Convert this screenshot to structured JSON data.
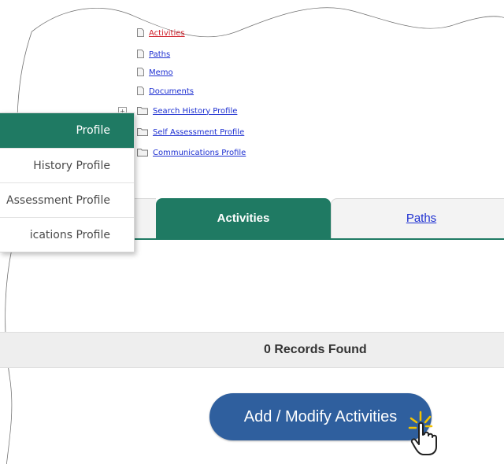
{
  "tree": {
    "items": [
      {
        "label": "Activities",
        "icon": "document-icon",
        "highlight": true
      },
      {
        "label": "Paths",
        "icon": "document-icon"
      },
      {
        "label": "Memo",
        "icon": "document-icon"
      },
      {
        "label": "Documents",
        "icon": "document-icon"
      },
      {
        "label": "Search History Profile",
        "icon": "folder-icon",
        "expandable": true
      },
      {
        "label": "Self Assessment Profile",
        "icon": "folder-icon"
      },
      {
        "label": "Communications Profile",
        "icon": "folder-icon"
      }
    ],
    "expand_symbol": "+"
  },
  "dropdown": {
    "items": [
      {
        "label": "Profile",
        "active": true
      },
      {
        "label": "History Profile"
      },
      {
        "label": "Assessment Profile"
      },
      {
        "label": "ications Profile"
      }
    ]
  },
  "tabs": {
    "activities": "Activities",
    "paths": "Paths"
  },
  "records": {
    "text": "0 Records Found"
  },
  "button": {
    "label": "Add / Modify Activities"
  },
  "colors": {
    "primary_green": "#1f7a63",
    "link_blue": "#1d2fd1",
    "button_blue": "#2f5f9e",
    "records_bg": "#eeeeee"
  }
}
